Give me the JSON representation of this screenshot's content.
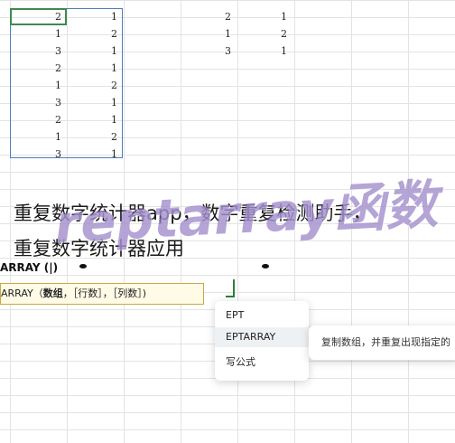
{
  "sheet": {
    "columnA": [
      "2",
      "1",
      "3",
      "2",
      "1",
      "3",
      "2",
      "1",
      "3"
    ],
    "columnB": [
      "1",
      "2",
      "1",
      "1",
      "2",
      "1",
      "1",
      "2",
      "1"
    ],
    "columnD": [
      "2",
      "1",
      "3"
    ],
    "columnE": [
      "1",
      "2",
      "1"
    ]
  },
  "formula": {
    "name_label": "ARRAY (",
    "cursor": "|",
    "name_suffix": ")",
    "tip_prefix": "ARRAY（",
    "tip_bold": "数组",
    "tip_rest": "，［行数］，［列数］)"
  },
  "dropdown": {
    "items": [
      "EPT",
      "EPTARRAY",
      "写公式"
    ],
    "description": "复制数组，并重复出现指定的"
  },
  "overlay": {
    "line1": "重复数字统计器app，数字重复检测助手，",
    "line2": "重复数字统计器应用",
    "watermark": "reptarray函数"
  },
  "colors": {
    "selection": "#4a7ebb",
    "active_cell": "#3f8a4e",
    "tip_bg": "#fffbe6",
    "watermark": "#785ab4"
  }
}
